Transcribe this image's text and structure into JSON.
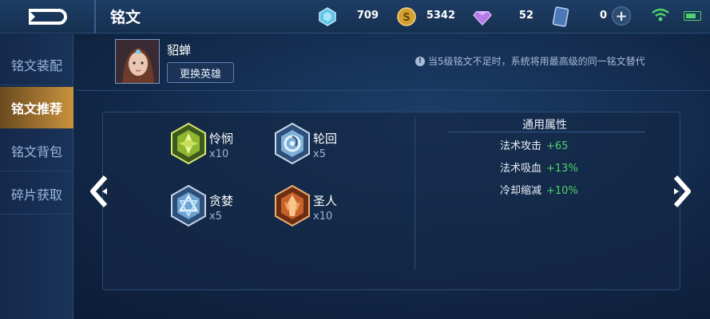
{
  "header": {
    "title": "铭文",
    "currencies": [
      {
        "icon": "diamond-gem-icon",
        "value": "709"
      },
      {
        "icon": "gold-coin-icon",
        "value": "5342"
      },
      {
        "icon": "purple-crystal-icon",
        "value": "52"
      },
      {
        "icon": "card-voucher-icon",
        "value": "0"
      }
    ]
  },
  "sidebar": {
    "items": [
      {
        "label": "铭文装配",
        "active": false
      },
      {
        "label": "铭文推荐",
        "active": true
      },
      {
        "label": "铭文背包",
        "active": false
      },
      {
        "label": "碎片获取",
        "active": false
      }
    ]
  },
  "hero": {
    "name": "貂蝉",
    "change_button": "更换英雄"
  },
  "notice": "当5级铭文不足时，系统将用最高级的同一铭文替代",
  "runes": [
    {
      "name": "怜悯",
      "count": "x10",
      "icon": "green-rune-icon"
    },
    {
      "name": "轮回",
      "count": "x5",
      "icon": "blue-rune-icon"
    },
    {
      "name": "贪婪",
      "count": "x5",
      "icon": "blue-rune-icon"
    },
    {
      "name": "圣人",
      "count": "x10",
      "icon": "red-rune-icon"
    }
  ],
  "attributes": {
    "title": "通用属性",
    "rows": [
      {
        "label": "法术攻击",
        "value": "+65"
      },
      {
        "label": "法术吸血",
        "value": "+13%"
      },
      {
        "label": "冷却缩减",
        "value": "+10%"
      }
    ]
  },
  "colors": {
    "accent_gold": "#c9933e",
    "positive_green": "#4fd36a",
    "panel_blue": "#142846"
  }
}
